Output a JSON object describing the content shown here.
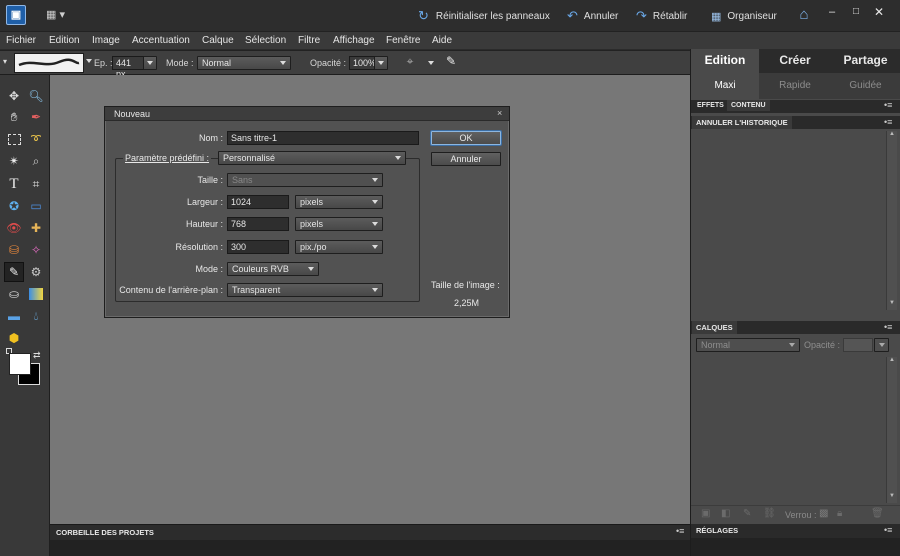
{
  "titlebar": {
    "reset_panels": "Réinitialiser les panneaux",
    "undo": "Annuler",
    "redo": "Rétablir",
    "organizer": "Organiseur"
  },
  "menu": [
    "Fichier",
    "Edition",
    "Image",
    "Accentuation",
    "Calque",
    "Sélection",
    "Filtre",
    "Affichage",
    "Fenêtre",
    "Aide"
  ],
  "options": {
    "size_label": "Ep. :",
    "size_value": "441 px",
    "mode_label": "Mode :",
    "mode_value": "Normal",
    "opacity_label": "Opacité :",
    "opacity_value": "100%"
  },
  "right_tabs": {
    "tabs": [
      "Edition",
      "Créer",
      "Partage"
    ],
    "subtabs": [
      "Maxi",
      "Rapide",
      "Guidée"
    ]
  },
  "panels": {
    "effects_tab": "EFFETS",
    "content_tab": "CONTENU",
    "history": "ANNULER L'HISTORIQUE",
    "layers": "CALQUES",
    "layers_mode": "Normal",
    "layers_opacity": "Opacité :",
    "lock_label": "Verrou :",
    "adjustments": "RÉGLAGES",
    "project_bin": "CORBEILLE DES PROJETS"
  },
  "dialog": {
    "title": "Nouveau",
    "name_label": "Nom :",
    "name_value": "Sans titre-1",
    "preset_label": "Paramètre prédéfini :",
    "preset_value": "Personnalisé",
    "size_label": "Taille :",
    "size_value": "Sans",
    "width_label": "Largeur :",
    "width_value": "1024",
    "width_unit": "pixels",
    "height_label": "Hauteur :",
    "height_value": "768",
    "height_unit": "pixels",
    "resolution_label": "Résolution :",
    "resolution_value": "300",
    "resolution_unit": "pix./po",
    "mode_label": "Mode :",
    "mode_value": "Couleurs RVB",
    "background_label": "Contenu de l'arrière-plan :",
    "background_value": "Transparent",
    "ok": "OK",
    "cancel": "Annuler",
    "image_size_label": "Taille de l'image :",
    "image_size_value": "2,25M"
  }
}
